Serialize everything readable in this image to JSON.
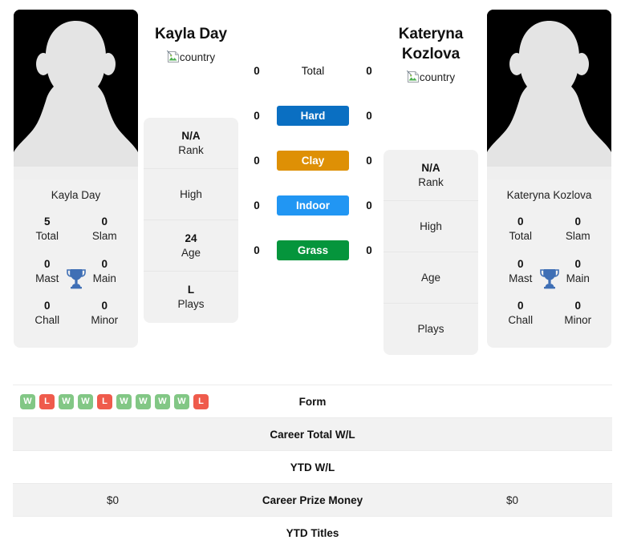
{
  "players": {
    "left": {
      "name": "Kayla Day",
      "photo_caption": "Kayla Day",
      "country_alt": "country",
      "titles": [
        {
          "value": "5",
          "label": "Total"
        },
        {
          "value": "0",
          "label": "Slam"
        },
        {
          "value": "0",
          "label": "Mast"
        },
        {
          "value": "0",
          "label": "Main"
        },
        {
          "value": "0",
          "label": "Chall"
        },
        {
          "value": "0",
          "label": "Minor"
        }
      ],
      "info": [
        {
          "value": "N/A",
          "label": "Rank"
        },
        {
          "value": "",
          "label": "High"
        },
        {
          "value": "24",
          "label": "Age"
        },
        {
          "value": "L",
          "label": "Plays"
        }
      ]
    },
    "right": {
      "name": "Kateryna Kozlova",
      "photo_caption": "Kateryna Kozlova",
      "country_alt": "country",
      "titles": [
        {
          "value": "0",
          "label": "Total"
        },
        {
          "value": "0",
          "label": "Slam"
        },
        {
          "value": "0",
          "label": "Mast"
        },
        {
          "value": "0",
          "label": "Main"
        },
        {
          "value": "0",
          "label": "Chall"
        },
        {
          "value": "0",
          "label": "Minor"
        }
      ],
      "info": [
        {
          "value": "N/A",
          "label": "Rank"
        },
        {
          "value": "",
          "label": "High"
        },
        {
          "value": "",
          "label": "Age"
        },
        {
          "value": "",
          "label": "Plays"
        }
      ]
    }
  },
  "surfaces": [
    {
      "label": "Total",
      "left": "0",
      "right": "0",
      "color": "transparent",
      "plain": true
    },
    {
      "label": "Hard",
      "left": "0",
      "right": "0",
      "color": "#0a6fc2",
      "plain": false
    },
    {
      "label": "Clay",
      "left": "0",
      "right": "0",
      "color": "#de9005",
      "plain": false
    },
    {
      "label": "Indoor",
      "left": "0",
      "right": "0",
      "color": "#2196f3",
      "plain": false
    },
    {
      "label": "Grass",
      "left": "0",
      "right": "0",
      "color": "#05953c",
      "plain": false
    }
  ],
  "stat_rows": [
    {
      "label": "Form",
      "left_value": "",
      "right_value": "",
      "shaded": false,
      "form": [
        "W",
        "L",
        "W",
        "W",
        "L",
        "W",
        "W",
        "W",
        "W",
        "L"
      ]
    },
    {
      "label": "Career Total W/L",
      "left_value": "",
      "right_value": "",
      "shaded": true
    },
    {
      "label": "YTD W/L",
      "left_value": "",
      "right_value": "",
      "shaded": false
    },
    {
      "label": "Career Prize Money",
      "left_value": "$0",
      "right_value": "$0",
      "shaded": true
    },
    {
      "label": "YTD Titles",
      "left_value": "",
      "right_value": "",
      "shaded": false
    }
  ],
  "colors": {
    "win": "#82c785",
    "loss": "#ef5b4c",
    "trophy": "#3f6fb5",
    "card_bg": "#f1f1f1"
  }
}
